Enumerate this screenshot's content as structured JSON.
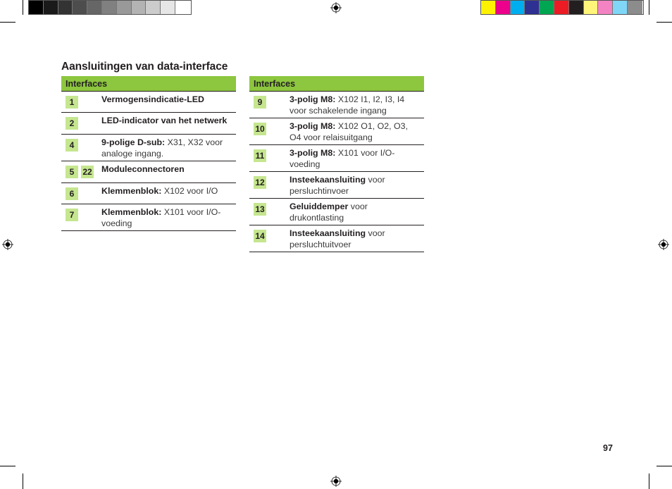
{
  "print_marks": {
    "gray_swatches": [
      "#000000",
      "#1a1a1a",
      "#333333",
      "#4d4d4d",
      "#666666",
      "#808080",
      "#999999",
      "#b3b3b3",
      "#cccccc",
      "#e6e6e6",
      "#ffffff"
    ],
    "color_swatches": [
      "#fff200",
      "#ec008c",
      "#00aeef",
      "#2e3192",
      "#00a651",
      "#ed1c24",
      "#231f20",
      "#fff57a",
      "#f383c3",
      "#7fd6f7",
      "#8c8c8c"
    ]
  },
  "page": {
    "title": "Aansluitingen van data-interface",
    "page_number": "97",
    "accent_color": "#8dc63f",
    "badge_color": "#c5e68f"
  },
  "left_table": {
    "header": "Interfaces",
    "rows": [
      {
        "badges": [
          "1"
        ],
        "bold": "Vermogensindicatie-LED",
        "text": ""
      },
      {
        "badges": [
          "2"
        ],
        "bold": "LED-indicator van het netwerk",
        "text": ""
      },
      {
        "badges": [
          "4"
        ],
        "bold": "9-polige D-sub:",
        "text": " X31, X32 voor analoge ingang."
      },
      {
        "badges": [
          "5",
          "22"
        ],
        "bold": "Moduleconnectoren",
        "text": ""
      },
      {
        "badges": [
          "6"
        ],
        "bold": "Klemmenblok:",
        "text": " X102 voor I/O"
      },
      {
        "badges": [
          "7"
        ],
        "bold": "Klemmenblok:",
        "text": " X101 voor I/O-voeding"
      }
    ]
  },
  "right_table": {
    "header": "Interfaces",
    "rows": [
      {
        "badges": [
          "9"
        ],
        "bold": "3-polig M8:",
        "text": " X102 I1, I2, I3, I4 voor schakelende ingang"
      },
      {
        "badges": [
          "10"
        ],
        "bold": "3-polig M8:",
        "text": " X102 O1, O2, O3, O4 voor relaisuitgang"
      },
      {
        "badges": [
          "11"
        ],
        "bold": "3-polig M8:",
        "text": " X101 voor I/O-voeding"
      },
      {
        "badges": [
          "12"
        ],
        "bold": "Insteekaansluiting",
        "text": " voor persluchtinvoer"
      },
      {
        "badges": [
          "13"
        ],
        "bold": "Geluiddemper",
        "text": " voor drukontlasting"
      },
      {
        "badges": [
          "14"
        ],
        "bold": "Insteekaansluiting",
        "text": " voor persluchtuitvoer"
      }
    ]
  }
}
